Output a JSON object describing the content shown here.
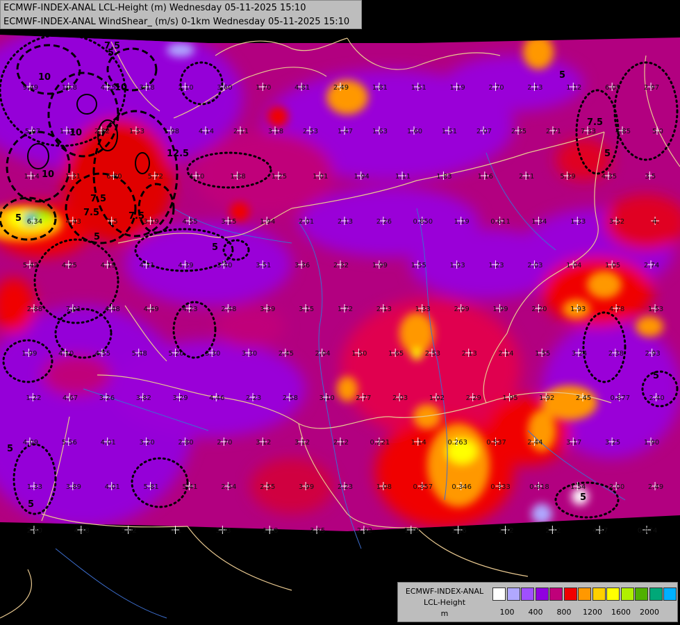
{
  "title": {
    "line1": "ECMWF-INDEX-ANAL LCL-Height (m) Wednesday 05-11-2025 15:10",
    "line2": "ECMWF-INDEX-ANAL WindShear_ (m/s) 0-1km Wednesday 05-11-2025 15:10"
  },
  "legend": {
    "line1": "ECMWF-INDEX-ANAL",
    "line2": "LCL-Height",
    "unit": "m",
    "colors": [
      "#ffffff",
      "#b0a8ff",
      "#a050ff",
      "#9000e0",
      "#c0007a",
      "#f00000",
      "#ff9800",
      "#ffd000",
      "#ffff00",
      "#b0f000",
      "#50b000",
      "#00a878",
      "#00b0ff"
    ],
    "ticks": [
      "100",
      "400",
      "800",
      "1200",
      "1600",
      "2000"
    ]
  },
  "contour_labels": [
    "5",
    "5",
    "5",
    "5",
    "7.5",
    "7.5",
    "7.5",
    "7.5",
    "10",
    "10",
    "10",
    "10",
    "12.5",
    "7.5",
    "5",
    "5",
    "5",
    "5",
    "5",
    "5"
  ],
  "station_values": [
    "9.49",
    "10.8",
    "4.25",
    "3.18",
    "2.10",
    "3.60",
    "1.70",
    "4.81",
    "2.49",
    "1.81",
    "1.51",
    "1.19",
    "2.70",
    "2.13",
    "1.12",
    "6.05",
    "2.97",
    "5.07",
    "1.14",
    "2.82",
    "1.53",
    "1.98",
    "4.14",
    "2.11",
    "3.18",
    "2.53",
    "1.47",
    "1.63",
    "1.60",
    "1.51",
    "2.07",
    "2.35",
    "2.71",
    "7.33",
    "4.85",
    "5.0",
    "1.14",
    "1.31",
    "6.80",
    "5.72",
    "4.10",
    "1.88",
    "1.25",
    "1.01",
    "1.94",
    "1.11",
    "1.83",
    "1.16",
    "2.11",
    "5.39",
    "4.35",
    "3.5",
    "6.34",
    "4.43",
    "7.5",
    "3.19",
    "4.55",
    "3.15",
    "1.94",
    "2.01",
    "2.13",
    "2.26",
    "0.850",
    "1.19",
    "0.611",
    "1.34",
    "1.33",
    "3.52",
    "4.",
    "5.42",
    "4.25",
    "4.19",
    "4.11",
    "4.39",
    "3.40",
    "3.51",
    "3.36",
    "2.32",
    "1.99",
    "1.55",
    "1.93",
    "1.23",
    "2.03",
    "1.04",
    "1.05",
    "2.74",
    "2.88",
    "7.01",
    "4.48",
    "4.49",
    "4.23",
    "2.48",
    "3.39",
    "3.15",
    "1.72",
    "2.13",
    "1.33",
    "2.09",
    "1.99",
    "2.20",
    "1.93",
    "4.78",
    "1.53",
    "1.99",
    "4.10",
    "4.55",
    "5.48",
    "5.20",
    "3.30",
    "3.30",
    "2.45",
    "2.04",
    "1.50",
    "1.65",
    "2.53",
    "2.13",
    "2.14",
    "1.55",
    "3.24",
    "2.38",
    "2.93",
    "1.22",
    "4.67",
    "3.26",
    "3.82",
    "3.29",
    "4.46",
    "2.23",
    "2.58",
    "3.10",
    "2.77",
    "2.03",
    "1.02",
    "2.29",
    "1.95",
    "1.92",
    "2.45",
    "0.877",
    "2.40",
    "4.09",
    "5.56",
    "4.01",
    "3.20",
    "2.80",
    "2.70",
    "3.12",
    "3.12",
    "2.12",
    "0.221",
    "1.14",
    "0.263",
    "0.537",
    "2.44",
    "3.17",
    "3.25",
    "1.90",
    "1.33",
    "3.89",
    "4.01",
    "5.81",
    "5.41",
    "2.54",
    "2.55",
    "3.99",
    "2.23",
    "1.08",
    "0.357",
    "0.346",
    "0.333",
    "0.918",
    "1.54",
    "2.00",
    "2.49",
    "2.60",
    "4.38",
    "5.02",
    "4.1",
    "3.03",
    "1.18",
    "3.85",
    "2.82",
    "1.19",
    "1.16",
    "1.32",
    "2.12",
    "4.57",
    "0.474",
    "1.71"
  ]
}
